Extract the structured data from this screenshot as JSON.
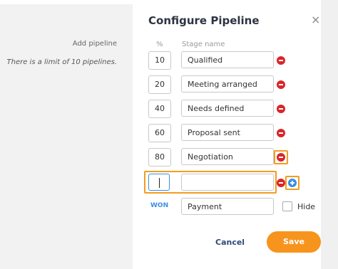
{
  "background": {
    "add_pipeline": "Add pipeline",
    "limit_note": "There is a limit of 10 pipelines."
  },
  "dialog": {
    "title": "Configure Pipeline",
    "close_icon": "×",
    "header_percent": "%",
    "header_stage_name": "Stage name",
    "stages": [
      {
        "percent": "10",
        "name": "Qualified"
      },
      {
        "percent": "20",
        "name": "Meeting arranged"
      },
      {
        "percent": "40",
        "name": "Needs defined"
      },
      {
        "percent": "60",
        "name": "Proposal sent"
      },
      {
        "percent": "80",
        "name": "Negotiation"
      }
    ],
    "new_stage": {
      "percent": "",
      "name": ""
    },
    "won_label": "WON",
    "won_stage_name": "Payment",
    "hide_label": "Hide",
    "cancel_label": "Cancel",
    "save_label": "Save"
  },
  "colors": {
    "accent_orange": "#f7941d",
    "remove_red": "#d9262c",
    "add_blue": "#3a8ee6",
    "highlight": "#f39c1e"
  },
  "icons": {
    "remove": "minus-circle-icon",
    "add": "plus-circle-icon",
    "close": "close-icon"
  }
}
